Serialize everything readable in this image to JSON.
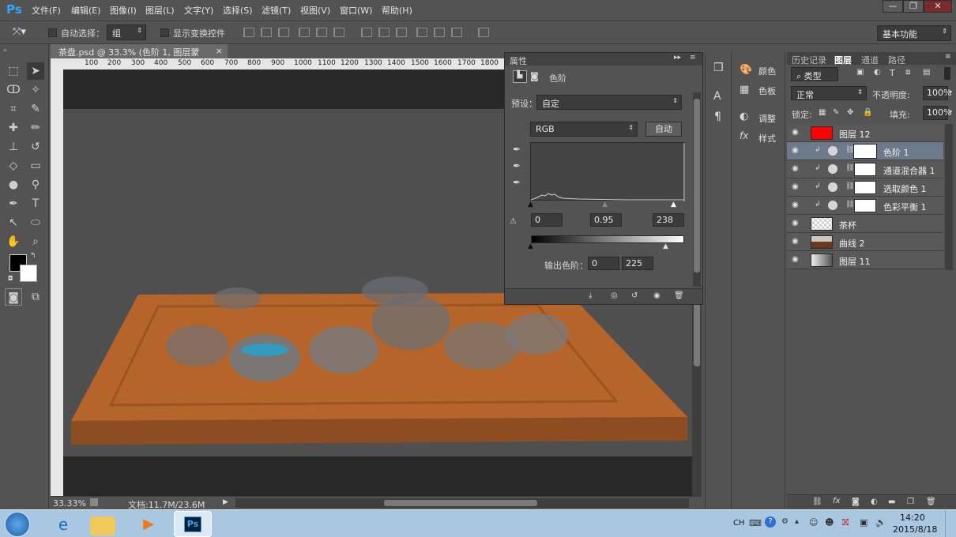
{
  "app": {
    "logo": "Ps"
  },
  "menu": [
    "文件(F)",
    "编辑(E)",
    "图像(I)",
    "图层(L)",
    "文字(Y)",
    "选择(S)",
    "滤镜(T)",
    "视图(V)",
    "窗口(W)",
    "帮助(H)"
  ],
  "window_buttons": {
    "minimize": "—",
    "restore": "❐",
    "close": "✕"
  },
  "options": {
    "auto_select_label": "自动选择：",
    "auto_select_value": "组",
    "show_transform_label": "显示变换控件",
    "workspace": "基本功能"
  },
  "document": {
    "tab_title": "茶盘.psd @ 33.3% (色阶 1, 图层蒙版/8) *",
    "tab_close": "×",
    "ruler_h": [
      "100",
      "200",
      "300",
      "400",
      "500",
      "600",
      "700",
      "800",
      "900",
      "1000",
      "1100",
      "1200",
      "1300",
      "1400",
      "1500",
      "1600",
      "1700",
      "1800"
    ],
    "zoom": "33.33%",
    "doc_info": "文档:11.7M/23.6M"
  },
  "properties": {
    "title": "属性",
    "panel_name": "色阶",
    "preset_label": "预设：",
    "preset_value": "自定",
    "channel": "RGB",
    "auto_button": "自动",
    "input_black": "0",
    "input_gamma": "0.95",
    "input_white": "238",
    "output_label": "输出色阶：",
    "output_black": "0",
    "output_white": "225"
  },
  "mid_panel": {
    "items": [
      {
        "label": "颜色",
        "icon": "palette-icon"
      },
      {
        "label": "色板",
        "icon": "swatches-icon"
      },
      {
        "label": "调整",
        "icon": "adjustments-icon"
      },
      {
        "label": "样式",
        "icon": "styles-icon"
      }
    ]
  },
  "layers": {
    "tabs": [
      "历史记录",
      "图层",
      "通道",
      "路径"
    ],
    "active_tab": "图层",
    "filter_type": "类型",
    "blend_mode": "正常",
    "opacity_label": "不透明度:",
    "opacity_value": "100%",
    "lock_label": "锁定:",
    "fill_label": "填充:",
    "fill_value": "100%",
    "list": [
      {
        "name": "图层 12",
        "thumb": "red",
        "adjustment": false,
        "selected": false
      },
      {
        "name": "色阶 1",
        "thumb": "white",
        "adjustment": true,
        "selected": true
      },
      {
        "name": "通道混合器 1",
        "thumb": "white",
        "adjustment": true,
        "selected": false
      },
      {
        "name": "选取颜色 1",
        "thumb": "white",
        "adjustment": true,
        "selected": false
      },
      {
        "name": "色彩平衡 1",
        "thumb": "white",
        "adjustment": true,
        "selected": false
      },
      {
        "name": "茶杯",
        "thumb": "transparent",
        "adjustment": false,
        "selected": false
      },
      {
        "name": "曲线 2",
        "thumb": "photo",
        "adjustment": false,
        "selected": false
      },
      {
        "name": "图层 11",
        "thumb": "gradient",
        "adjustment": false,
        "selected": false
      }
    ]
  },
  "taskbar": {
    "lang": "CH",
    "time": "14:20",
    "date": "2015/8/18"
  },
  "colors": {
    "layer12_thumb": "#ff0000",
    "selected_row": "#6d7a8c",
    "tray_orange": "#c56a2a",
    "ps_blue": "#31a8ff"
  }
}
